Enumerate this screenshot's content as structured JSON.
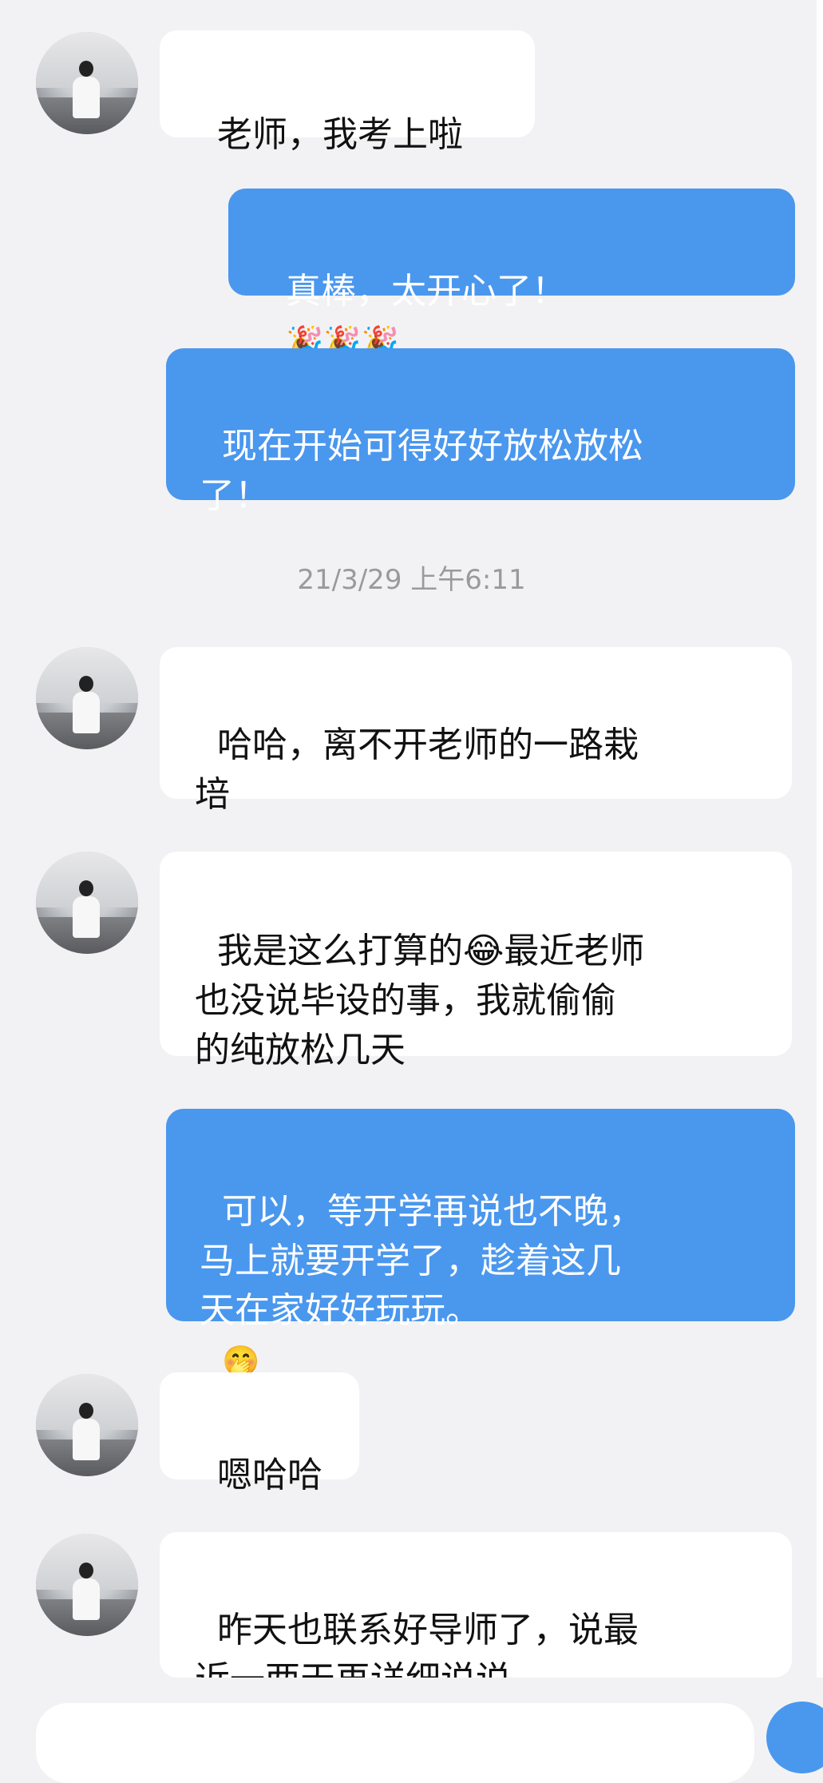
{
  "messages": [
    {
      "side": "left",
      "text": "老师，我考上啦"
    },
    {
      "side": "right",
      "text": "真棒，太开心了！",
      "emoji": "🎉🎉🎉"
    },
    {
      "side": "right",
      "text": "现在开始可得好好放松放松\n了！"
    },
    {
      "timestamp": "21/3/29 上午6:11"
    },
    {
      "side": "left",
      "text": "哈哈，离不开老师的一路栽\n培"
    },
    {
      "side": "left",
      "text": "我是这么打算的😂最近老师\n也没说毕设的事，我就偷偷\n的纯放松几天"
    },
    {
      "side": "right",
      "text": "可以，等开学再说也不晚，\n马上就要开学了，趁着这几\n天在家好好玩玩。",
      "emoji": "🤭"
    },
    {
      "side": "left",
      "text": "嗯哈哈"
    },
    {
      "side": "left",
      "text": "昨天也联系好导师了，说最\n近一两天再详细说说"
    }
  ],
  "colors": {
    "background": "#f2f2f4",
    "sent_bubble": "#4a97ee",
    "received_bubble": "#ffffff",
    "timestamp": "#9a9a9a"
  }
}
